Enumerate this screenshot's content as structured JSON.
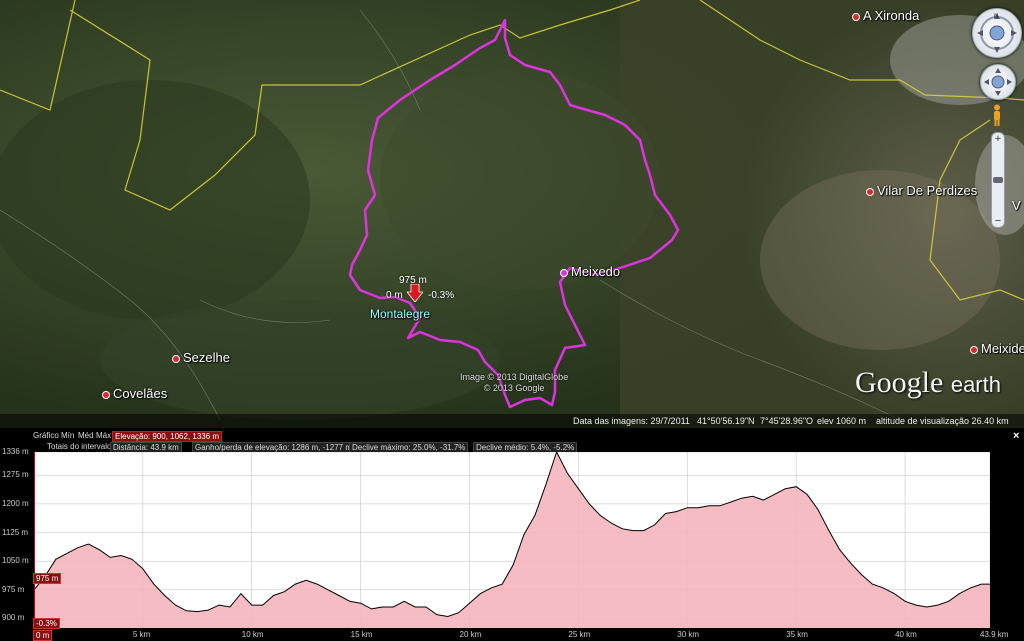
{
  "map": {
    "places": [
      {
        "name": "A Xironda"
      },
      {
        "name": "Vilar De Perdizes"
      },
      {
        "name": "Meixedo"
      },
      {
        "name": "Meixide"
      },
      {
        "name": "Sezelhe"
      },
      {
        "name": "Covelães"
      },
      {
        "name": "Montalegre"
      },
      {
        "name": "V"
      }
    ],
    "marker": {
      "elev": "975 m",
      "dist": "0 m",
      "slope": "-0.3%"
    },
    "copyright": [
      "Image © 2013 DigitalGlobe",
      "© 2013 Google"
    ],
    "logo": {
      "main": "Google",
      "sub": "earth"
    },
    "route_color": "#e033e0",
    "border_color": "#d9d23a"
  },
  "statusbar": {
    "image_date": "Data das imagens: 29/7/2011",
    "lat": "41°50'56.19\"N",
    "lon": "7°45'28.96\"O",
    "elev": "elev  1060 m",
    "altitude": "altitude de visualização  26.40 km"
  },
  "profile": {
    "header_row1": {
      "graph": "Gráfico",
      "min": "Mín",
      "med": "Méd",
      "max": "Máx",
      "elevation": "Elevação: 900, 1062, 1336 m"
    },
    "header_row2": {
      "totals": "Totais do intervalo",
      "distance": "Distância: 43.9 km",
      "gain": "Ganho/perda de elevação: 1286 m, -1277 m",
      "max_slope": "Declive máximo: 25.0%, -31.7%",
      "avg_slope": "Declive médio: 5.4%, -5.2%"
    },
    "close_label": "×",
    "current_elev_tag": "975 m",
    "current_slope_tag": "-0.3%",
    "start_tag": "0 m"
  },
  "chart_data": {
    "type": "area",
    "xlabel": "",
    "ylabel": "",
    "ylim": [
      875,
      1336
    ],
    "xlim": [
      0,
      43.9
    ],
    "y_ticks": [
      "1336 m",
      "1275 m",
      "1200 m",
      "1125 m",
      "1050 m",
      "975 m",
      "900 m"
    ],
    "x_ticks": [
      "5 km",
      "10 km",
      "15 km",
      "20 km",
      "25 km",
      "30 km",
      "35 km",
      "40 km",
      "43.9 km"
    ],
    "grid": true,
    "fill_color": "#f4b5bd",
    "line_color": "#000000",
    "series": [
      {
        "x": [
          0,
          0.5,
          1,
          1.5,
          2,
          2.5,
          3,
          3.5,
          4,
          4.5,
          5,
          5.5,
          6,
          6.5,
          7,
          7.5,
          8,
          8.5,
          9,
          9.5,
          10,
          10.5,
          11,
          11.5,
          12,
          12.5,
          13,
          13.5,
          14,
          14.5,
          15,
          15.5,
          16,
          16.5,
          17,
          17.5,
          18,
          18.5,
          19,
          19.5,
          20,
          20.5,
          21,
          21.5,
          22,
          22.5,
          23,
          23.5,
          24,
          24.5,
          25,
          25.5,
          26,
          26.5,
          27,
          27.5,
          28,
          28.5,
          29,
          29.5,
          30,
          30.5,
          31,
          31.5,
          32,
          32.5,
          33,
          33.5,
          34,
          34.5,
          35,
          35.5,
          36,
          36.5,
          37,
          37.5,
          38,
          38.5,
          39,
          39.5,
          40,
          40.5,
          41,
          41.5,
          42,
          42.5,
          43,
          43.5,
          43.9
        ],
        "y": [
          975,
          1010,
          1055,
          1070,
          1085,
          1095,
          1080,
          1060,
          1065,
          1055,
          1030,
          990,
          960,
          935,
          920,
          918,
          922,
          935,
          930,
          965,
          935,
          935,
          960,
          970,
          990,
          1000,
          990,
          975,
          960,
          945,
          940,
          925,
          930,
          930,
          945,
          930,
          930,
          910,
          905,
          915,
          940,
          965,
          980,
          990,
          1040,
          1120,
          1170,
          1250,
          1336,
          1280,
          1240,
          1200,
          1170,
          1150,
          1135,
          1130,
          1130,
          1145,
          1175,
          1180,
          1190,
          1190,
          1195,
          1195,
          1205,
          1215,
          1220,
          1210,
          1225,
          1240,
          1245,
          1225,
          1185,
          1130,
          1080,
          1045,
          1015,
          990,
          980,
          965,
          945,
          935,
          930,
          935,
          945,
          965,
          980,
          990,
          990
        ]
      }
    ]
  }
}
